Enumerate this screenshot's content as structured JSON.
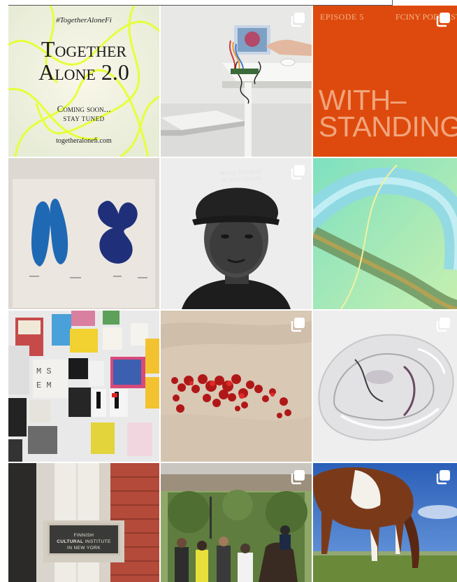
{
  "posts": [
    {
      "id": "p1",
      "multi": false,
      "hashtag": "#TogetherAloneFi",
      "title_line1": "Together",
      "title_line2": "Alone 2.0",
      "coming": "Coming soon...",
      "stay": "STAY TUNED",
      "url": "togetheraloneﬁ.com"
    },
    {
      "id": "p2",
      "multi": true
    },
    {
      "id": "p3",
      "multi": true,
      "episode": "EPISODE 5",
      "podcast": "FCINY PODCAST",
      "headline_line1": "WITH–",
      "headline_line2": "STANDING"
    },
    {
      "id": "p4",
      "multi": false
    },
    {
      "id": "p5",
      "multi": true,
      "cap_text_line1": "MAKE TECHNO",
      "cap_text_line2": "BLACK AGAIN"
    },
    {
      "id": "p6",
      "multi": false
    },
    {
      "id": "p7",
      "multi": false
    },
    {
      "id": "p8",
      "multi": true
    },
    {
      "id": "p9",
      "multi": true
    },
    {
      "id": "p10",
      "multi": false,
      "plaque_line1": "FINNISH",
      "plaque_line2_bold": "CULTURAL",
      "plaque_line2_rest": " INSTITUTE",
      "plaque_line3": "IN NEW YORK"
    },
    {
      "id": "p11",
      "multi": true
    },
    {
      "id": "p12",
      "multi": true
    }
  ],
  "icons": {
    "multi_post": "carousel-icon"
  },
  "colors": {
    "orange": "#de4a0d",
    "neon": "#e6ff3a"
  }
}
